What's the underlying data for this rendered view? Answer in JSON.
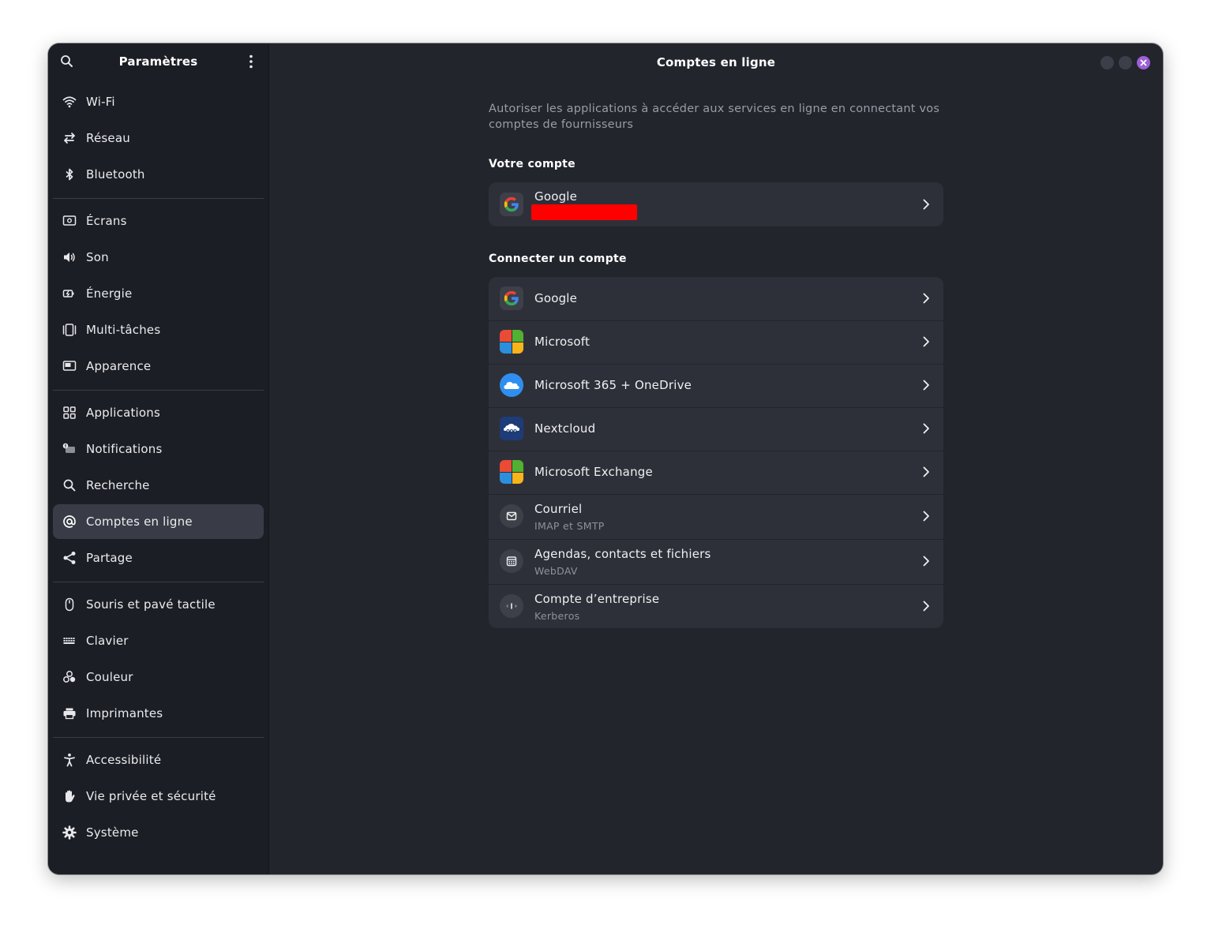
{
  "sidebar": {
    "title": "Paramètres",
    "groups": [
      [
        {
          "label": "Wi-Fi",
          "icon": "wifi-icon"
        },
        {
          "label": "Réseau",
          "icon": "network-icon"
        },
        {
          "label": "Bluetooth",
          "icon": "bluetooth-icon"
        }
      ],
      [
        {
          "label": "Écrans",
          "icon": "display-icon"
        },
        {
          "label": "Son",
          "icon": "speaker-icon"
        },
        {
          "label": "Énergie",
          "icon": "power-icon"
        },
        {
          "label": "Multi-tâches",
          "icon": "multitasking-icon"
        },
        {
          "label": "Apparence",
          "icon": "appearance-icon"
        }
      ],
      [
        {
          "label": "Applications",
          "icon": "apps-grid-icon"
        },
        {
          "label": "Notifications",
          "icon": "notification-icon"
        },
        {
          "label": "Recherche",
          "icon": "search-icon"
        },
        {
          "label": "Comptes en ligne",
          "icon": "at-sign-icon",
          "active": true
        },
        {
          "label": "Partage",
          "icon": "share-icon"
        }
      ],
      [
        {
          "label": "Souris et pavé tactile",
          "icon": "mouse-icon"
        },
        {
          "label": "Clavier",
          "icon": "keyboard-icon"
        },
        {
          "label": "Couleur",
          "icon": "color-icon"
        },
        {
          "label": "Imprimantes",
          "icon": "printer-icon"
        }
      ],
      [
        {
          "label": "Accessibilité",
          "icon": "accessibility-icon"
        },
        {
          "label": "Vie privée et sécurité",
          "icon": "privacy-hand-icon"
        },
        {
          "label": "Système",
          "icon": "gear-icon"
        }
      ]
    ]
  },
  "main": {
    "title": "Comptes en ligne",
    "description": "Autoriser les applications à accéder aux services en ligne en connectant vos comptes de fournisseurs",
    "your_account": {
      "heading": "Votre compte",
      "items": [
        {
          "title": "Google",
          "subtitle_redacted": true,
          "icon": "google-icon"
        }
      ]
    },
    "connect": {
      "heading": "Connecter un compte",
      "items": [
        {
          "title": "Google",
          "subtitle": "",
          "icon": "google-icon"
        },
        {
          "title": "Microsoft",
          "subtitle": "",
          "icon": "microsoft-icon"
        },
        {
          "title": "Microsoft 365 + OneDrive",
          "subtitle": "",
          "icon": "onedrive-cloud-icon"
        },
        {
          "title": "Nextcloud",
          "subtitle": "",
          "icon": "nextcloud-icon"
        },
        {
          "title": "Microsoft Exchange",
          "subtitle": "",
          "icon": "exchange-icon"
        },
        {
          "title": "Courriel",
          "subtitle": "IMAP et SMTP",
          "icon": "mail-icon"
        },
        {
          "title": "Agendas, contacts et fichiers",
          "subtitle": "WebDAV",
          "icon": "calendar-icon"
        },
        {
          "title": "Compte d’entreprise",
          "subtitle": "Kerberos",
          "icon": "kerberos-icon"
        }
      ]
    }
  },
  "colors": {
    "window_bg": "#22252c",
    "sidebar_bg": "#1c1e25",
    "card_bg": "#2e3039",
    "active_item_bg": "#393c47",
    "accent_close": "#9d5fd8",
    "redaction": "#ff0000"
  }
}
